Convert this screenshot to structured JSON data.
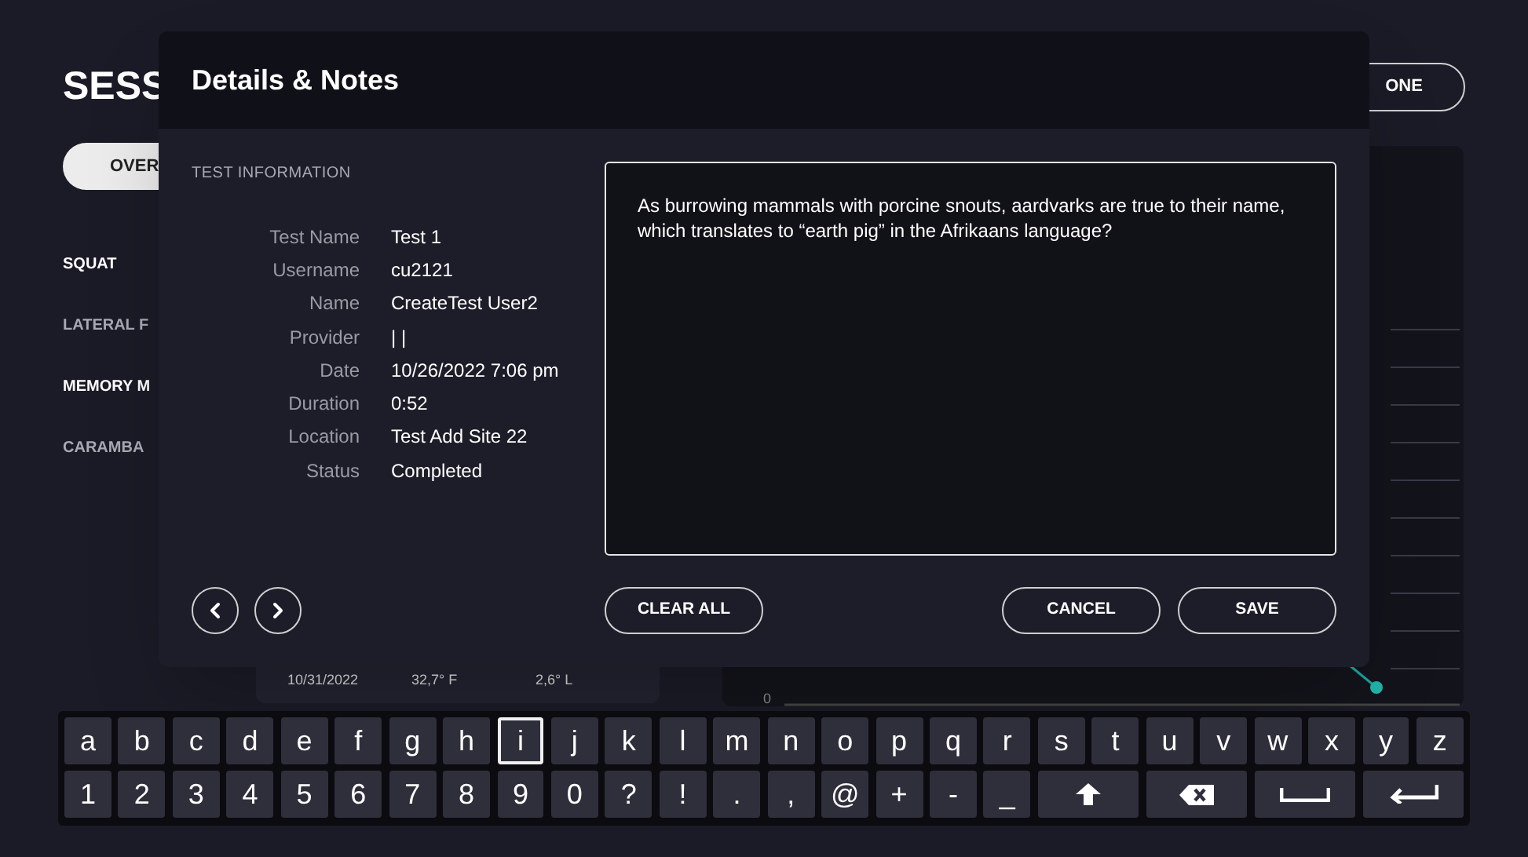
{
  "background": {
    "title": "SESS",
    "overview_button": "OVER",
    "done_button": "ONE",
    "sidebar": [
      {
        "label": "SQUAT",
        "bright": true
      },
      {
        "label": "LATERAL F",
        "bright": false
      },
      {
        "label": "MEMORY M",
        "bright": true
      },
      {
        "label": "CARAMBA",
        "bright": false
      }
    ],
    "table_row": [
      "10/31/2022",
      "32,7° F",
      "2,6° L"
    ],
    "chart_axis_labels": [
      "0"
    ]
  },
  "dialog": {
    "title": "Details & Notes",
    "section": "TEST INFORMATION",
    "fields": [
      {
        "label": "Test Name",
        "value": "Test 1"
      },
      {
        "label": "Username",
        "value": "cu2121"
      },
      {
        "label": "Name",
        "value": "CreateTest User2"
      },
      {
        "label": "Provider",
        "value": "| |"
      },
      {
        "label": "Date",
        "value": "10/26/2022 7:06 pm"
      },
      {
        "label": "Duration",
        "value": "0:52"
      },
      {
        "label": "Location",
        "value": "Test Add Site 22"
      },
      {
        "label": "Status",
        "value": "Completed"
      }
    ],
    "notes": "As burrowing mammals with porcine snouts, aardvarks are true to their name, which translates to “earth pig” in the Afrikaans language?",
    "buttons": {
      "clear": "CLEAR ALL",
      "cancel": "CANCEL",
      "save": "SAVE"
    }
  },
  "keyboard": {
    "rows": [
      [
        {
          "label": "a",
          "selected": false
        },
        {
          "label": "b",
          "selected": false
        },
        {
          "label": "c",
          "selected": false
        },
        {
          "label": "d",
          "selected": false
        },
        {
          "label": "e",
          "selected": false
        },
        {
          "label": "f",
          "selected": false
        },
        {
          "label": "g",
          "selected": false
        },
        {
          "label": "h",
          "selected": false
        },
        {
          "label": "i",
          "selected": true
        },
        {
          "label": "j",
          "selected": false
        },
        {
          "label": "k",
          "selected": false
        },
        {
          "label": "l",
          "selected": false
        },
        {
          "label": "m",
          "selected": false
        },
        {
          "label": "n",
          "selected": false
        },
        {
          "label": "o",
          "selected": false
        },
        {
          "label": "p",
          "selected": false
        },
        {
          "label": "q",
          "selected": false
        },
        {
          "label": "r",
          "selected": false
        },
        {
          "label": "s",
          "selected": false
        },
        {
          "label": "t",
          "selected": false
        },
        {
          "label": "u",
          "selected": false
        },
        {
          "label": "v",
          "selected": false
        },
        {
          "label": "w",
          "selected": false
        },
        {
          "label": "x",
          "selected": false
        },
        {
          "label": "y",
          "selected": false
        },
        {
          "label": "z",
          "selected": false
        }
      ],
      [
        {
          "label": "1",
          "selected": false
        },
        {
          "label": "2",
          "selected": false
        },
        {
          "label": "3",
          "selected": false
        },
        {
          "label": "4",
          "selected": false
        },
        {
          "label": "5",
          "selected": false
        },
        {
          "label": "6",
          "selected": false
        },
        {
          "label": "7",
          "selected": false
        },
        {
          "label": "8",
          "selected": false
        },
        {
          "label": "9",
          "selected": false
        },
        {
          "label": "0",
          "selected": false
        },
        {
          "label": "?",
          "selected": false
        },
        {
          "label": "!",
          "selected": false
        },
        {
          "label": ".",
          "selected": false
        },
        {
          "label": ",",
          "selected": false
        },
        {
          "label": "@",
          "selected": false
        },
        {
          "label": "+",
          "selected": false
        },
        {
          "label": "-",
          "selected": false
        },
        {
          "label": "_",
          "selected": false
        },
        {
          "kind": "shift",
          "selected": false
        },
        {
          "kind": "backspace",
          "selected": false
        },
        {
          "kind": "space",
          "selected": false
        },
        {
          "kind": "enter",
          "selected": false
        }
      ]
    ]
  }
}
